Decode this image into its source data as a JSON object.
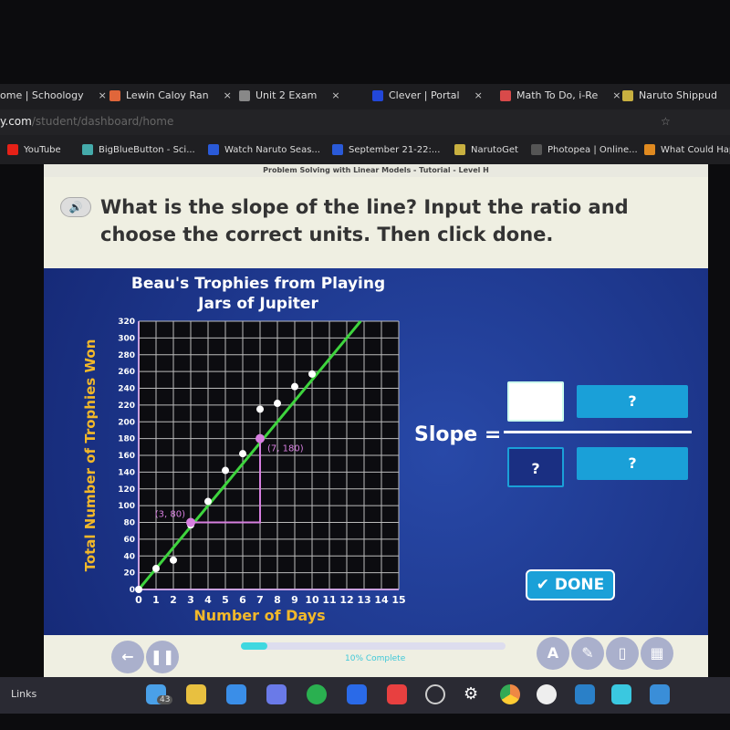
{
  "browser": {
    "tabs": [
      {
        "label": "ome | Schoology",
        "icon": "schoology-icon",
        "color": "#1d1d20"
      },
      {
        "label": "Lewin Caloy Ran",
        "icon": "slides-icon",
        "color": "#e0663a"
      },
      {
        "label": "Unit 2 Exam",
        "icon": "exam-icon",
        "color": "#888"
      },
      {
        "label": "Clever | Portal",
        "icon": "clever-icon",
        "color": "#2247d8"
      },
      {
        "label": "Math To Do, i-Re",
        "icon": "iready-icon",
        "color": "#d84a4a"
      },
      {
        "label": "Naruto Shippud",
        "icon": "naruto-icon",
        "color": "#c8b040"
      }
    ],
    "close_glyph": "×",
    "url_host": "y.com",
    "url_path": "/student/dashboard/home",
    "bookmarks": [
      {
        "label": "YouTube",
        "color": "#e62117"
      },
      {
        "label": "BigBlueButton - Sci...",
        "color": "#4aa"
      },
      {
        "label": "Watch Naruto Seas...",
        "color": "#2a5ad8"
      },
      {
        "label": "September 21-22:...",
        "color": "#2a5ad8"
      },
      {
        "label": "NarutoGet",
        "color": "#c8b040"
      },
      {
        "label": "Photopea | Online...",
        "color": "#555"
      },
      {
        "label": "What Could Happ",
        "color": "#e08a20"
      }
    ]
  },
  "lesson": {
    "title": "Problem Solving with Linear Models - Tutorial - Level H",
    "question": "What is the slope of the line? Input the ratio and choose the correct units. Then click done.",
    "slope_label": "Slope =",
    "numerator_value": "",
    "numerator_units": "?",
    "denominator_value": "?",
    "denominator_units": "?",
    "done_label": "✔ DONE",
    "progress_text": "10% Complete",
    "progress_percent": 10
  },
  "chart_data": {
    "type": "scatter",
    "title": "Beau's Trophies from Playing Jars of Jupiter",
    "title_line1": "Beau's Trophies from Playing",
    "title_line2": "Jars of Jupiter",
    "xlabel": "Number of Days",
    "ylabel": "Total Number of Trophies Won",
    "xlim": [
      0,
      15
    ],
    "ylim": [
      0,
      320
    ],
    "xticks": [
      0,
      1,
      2,
      3,
      4,
      5,
      6,
      7,
      8,
      9,
      10,
      11,
      12,
      13,
      14,
      15
    ],
    "yticks": [
      0,
      20,
      40,
      60,
      80,
      100,
      120,
      140,
      160,
      180,
      200,
      220,
      240,
      260,
      280,
      300,
      320
    ],
    "grid": true,
    "points": [
      [
        0,
        0
      ],
      [
        1,
        25
      ],
      [
        2,
        35
      ],
      [
        3,
        77
      ],
      [
        4,
        105
      ],
      [
        5,
        142
      ],
      [
        6,
        162
      ],
      [
        7,
        215
      ],
      [
        8,
        222
      ],
      [
        9,
        242
      ],
      [
        10,
        257
      ]
    ],
    "trend_line": {
      "slope": 25,
      "intercept": 0,
      "color": "#3ed43e"
    },
    "highlight_points": [
      {
        "x": 3,
        "y": 80,
        "label": "(3, 80)"
      },
      {
        "x": 7,
        "y": 180,
        "label": "(7, 180)"
      }
    ],
    "highlight_color": "#d77fe0",
    "axis_label_color": "#f2b82a"
  },
  "taskbar": {
    "links_label": "Links",
    "mail_badge": "43"
  }
}
